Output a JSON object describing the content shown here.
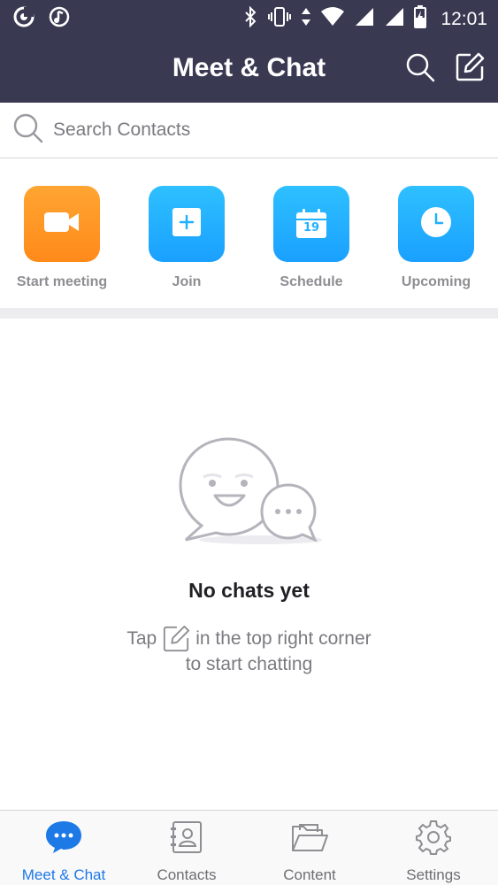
{
  "status_bar": {
    "time": "12:01",
    "left_icons": [
      "sync-app-icon",
      "music-app-icon"
    ],
    "right_icons": [
      "bluetooth-icon",
      "vibrate-icon",
      "data-arrows-icon",
      "wifi-icon",
      "signal-icon",
      "signal-icon-2",
      "battery-charging-icon"
    ]
  },
  "header": {
    "title": "Meet & Chat",
    "actions": [
      "search-icon",
      "compose-icon"
    ]
  },
  "search": {
    "placeholder": "Search Contacts"
  },
  "quick_actions": [
    {
      "label": "Start meeting",
      "icon": "video-camera-icon",
      "color": "#ff9a26"
    },
    {
      "label": "Join",
      "icon": "plus-icon",
      "color": "#22b0ff"
    },
    {
      "label": "Schedule",
      "icon": "calendar-icon",
      "color": "#22b0ff",
      "calendar_day": "19"
    },
    {
      "label": "Upcoming",
      "icon": "clock-icon",
      "color": "#22b0ff"
    }
  ],
  "empty_state": {
    "title": "No chats yet",
    "hint_before": "Tap",
    "hint_after": "in the top right corner",
    "hint_line2": "to start chatting"
  },
  "bottom_nav": {
    "active": "Meet & Chat",
    "items": [
      {
        "label": "Meet & Chat",
        "icon": "chat-bubble-icon"
      },
      {
        "label": "Contacts",
        "icon": "contacts-book-icon"
      },
      {
        "label": "Content",
        "icon": "folder-icon"
      },
      {
        "label": "Settings",
        "icon": "gear-icon"
      }
    ]
  },
  "colors": {
    "header_bg": "#393952",
    "accent_blue": "#1d79e6",
    "tile_orange": "#ff9a26",
    "tile_blue": "#22b0ff"
  }
}
